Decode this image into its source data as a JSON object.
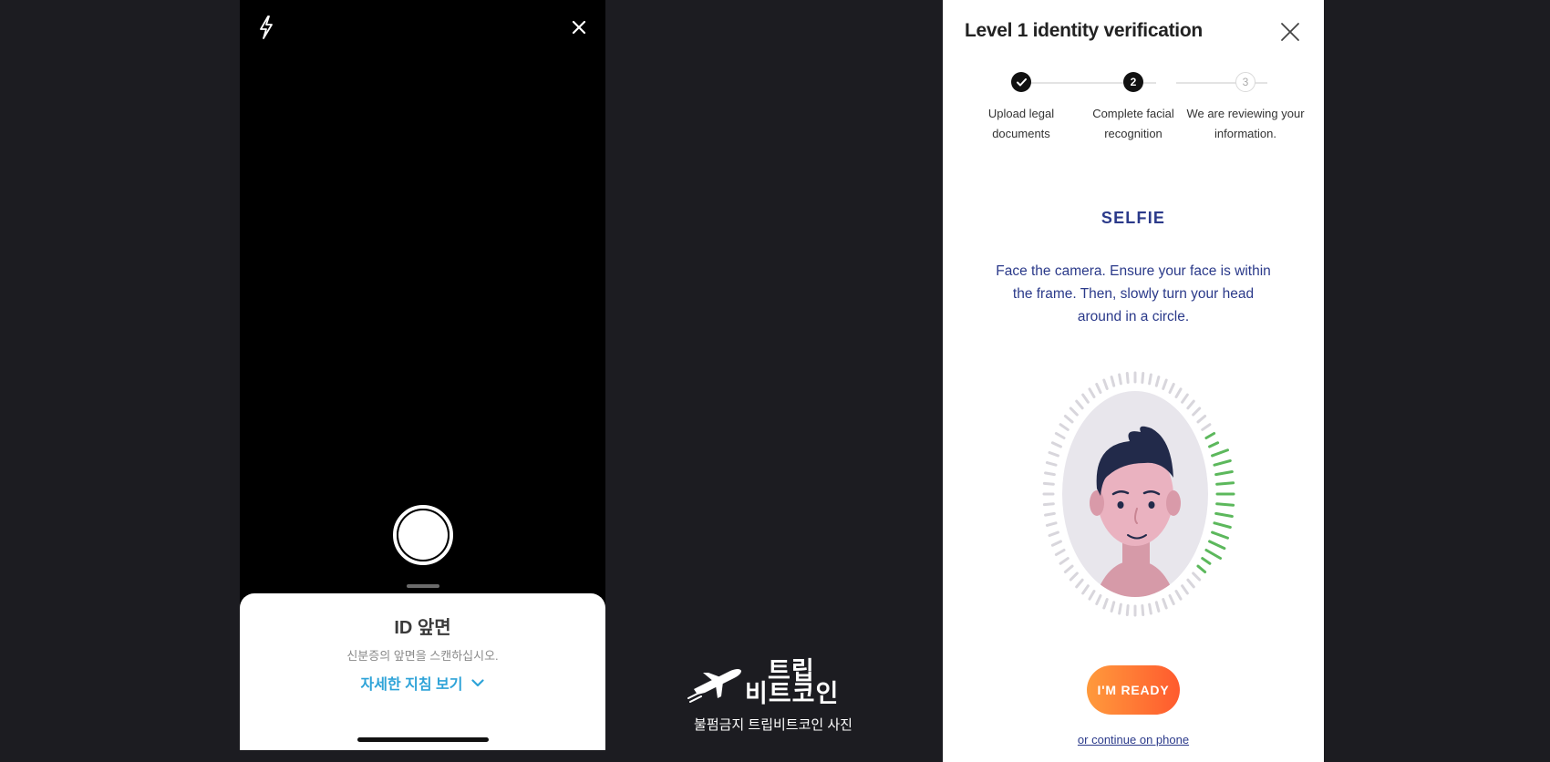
{
  "camera": {
    "flash_icon": "lightning-bolt-icon",
    "close_icon": "close-icon",
    "sheet_title": "ID 앞면",
    "sheet_subtitle": "신분증의 앞면을 스캔하십시오.",
    "guide_label": "자세한 지침 보기"
  },
  "watermark": {
    "line1": "트립",
    "line2": "비트코인",
    "caption": "불펌금지 트립비트코인 사진"
  },
  "verification": {
    "title": "Level 1 identity verification",
    "steps": [
      {
        "number": "1",
        "label": "Upload legal documents",
        "state": "done"
      },
      {
        "number": "2",
        "label": "Complete facial recognition",
        "state": "active"
      },
      {
        "number": "3",
        "label": "We are reviewing your information.",
        "state": "todo"
      }
    ],
    "heading": "SELFIE",
    "instructions": "Face the camera. Ensure your face is within the frame. Then, slowly turn your head around in a circle.",
    "ready_label": "I'M READY",
    "phone_link": "or continue on phone"
  },
  "colors": {
    "accent_blue": "#2b3a8a",
    "link_blue": "#2ea3d8",
    "button_orange_start": "#ff9a3c",
    "button_orange_end": "#ff5a2e",
    "progress_green": "#5cb85c"
  }
}
